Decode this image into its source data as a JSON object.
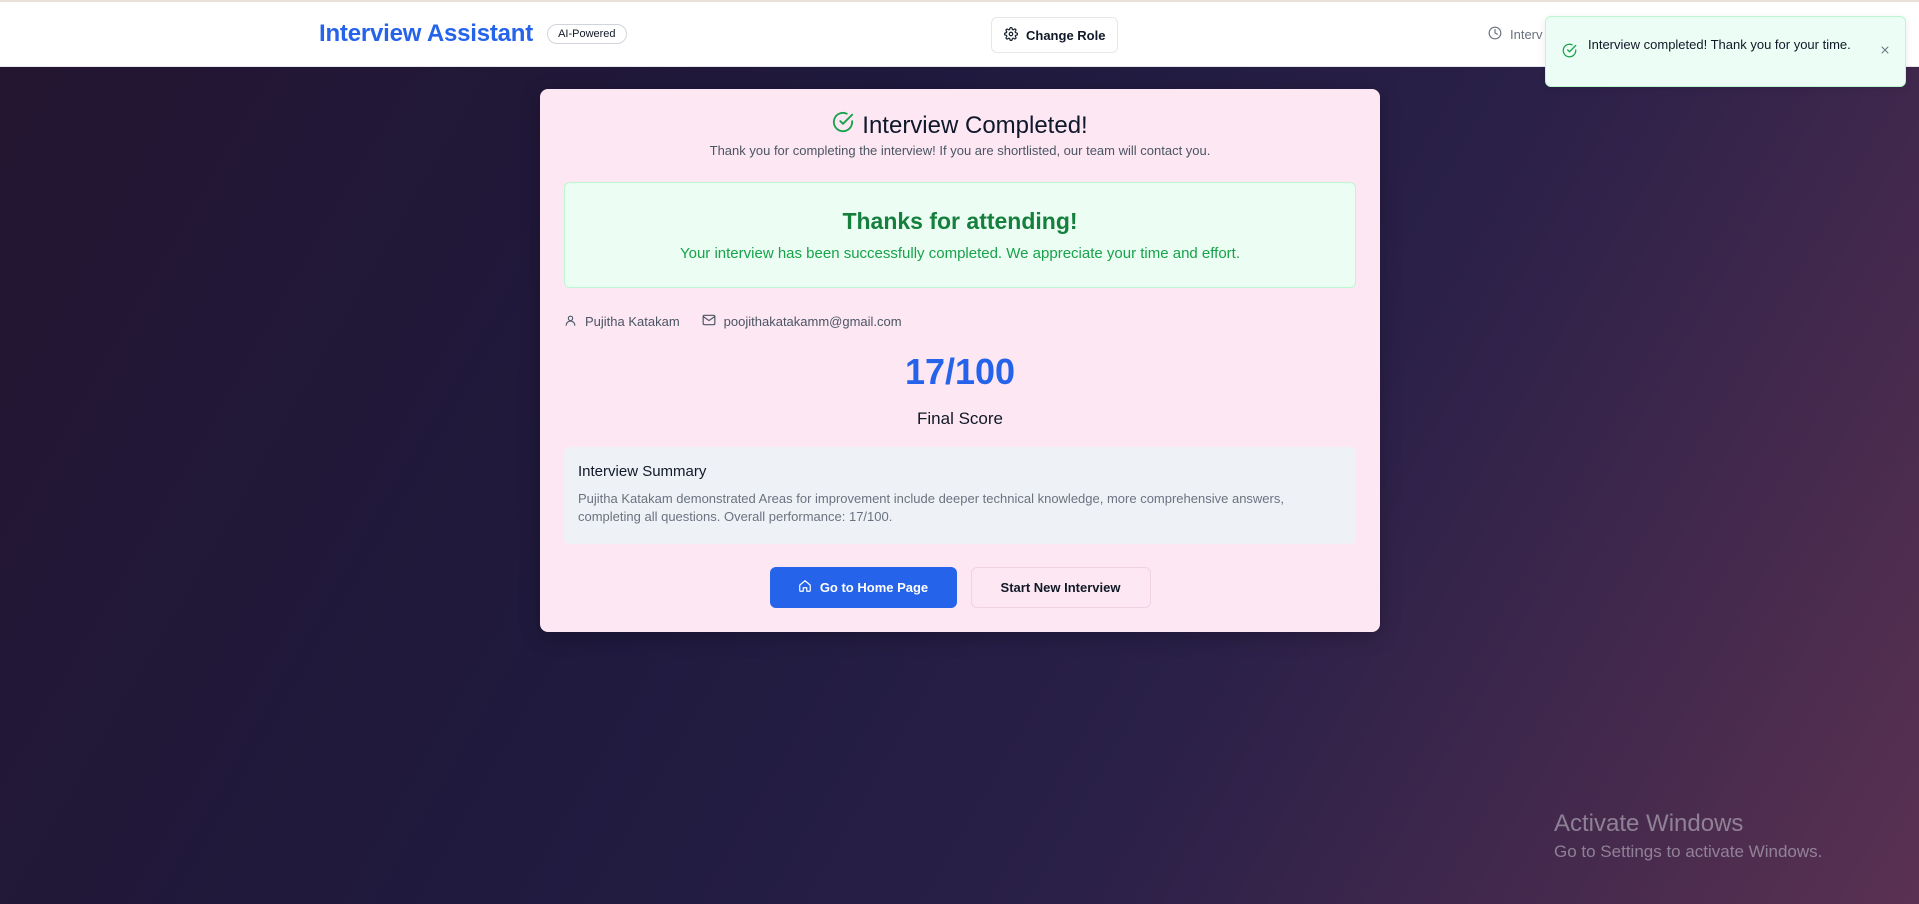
{
  "header": {
    "brand_title": "Interview Assistant",
    "badge": "AI-Powered",
    "change_role_label": "Change Role",
    "timer_text": "Interv"
  },
  "toast": {
    "message": "Interview completed! Thank you for your time."
  },
  "card": {
    "title": "Interview Completed!",
    "subtitle": "Thank you for completing the interview! If you are shortlisted, our team will contact you.",
    "thanks_heading": "Thanks for attending!",
    "thanks_message": "Your interview has been successfully completed. We appreciate your time and effort.",
    "candidate_name": "Pujitha Katakam",
    "candidate_email": "poojithakatakamm@gmail.com",
    "score": "17/100",
    "score_label": "Final Score",
    "summary_heading": "Interview Summary",
    "summary_text": "Pujitha Katakam demonstrated Areas for improvement include deeper technical knowledge, more comprehensive answers, completing all questions. Overall performance: 17/100.",
    "home_button_label": "Go to Home Page",
    "new_interview_button_label": "Start New Interview"
  },
  "watermark": {
    "title": "Activate Windows",
    "subtitle": "Go to Settings to activate Windows."
  },
  "colors": {
    "accent": "#2563eb",
    "success": "#15803d",
    "card_bg": "#fce7f3"
  }
}
